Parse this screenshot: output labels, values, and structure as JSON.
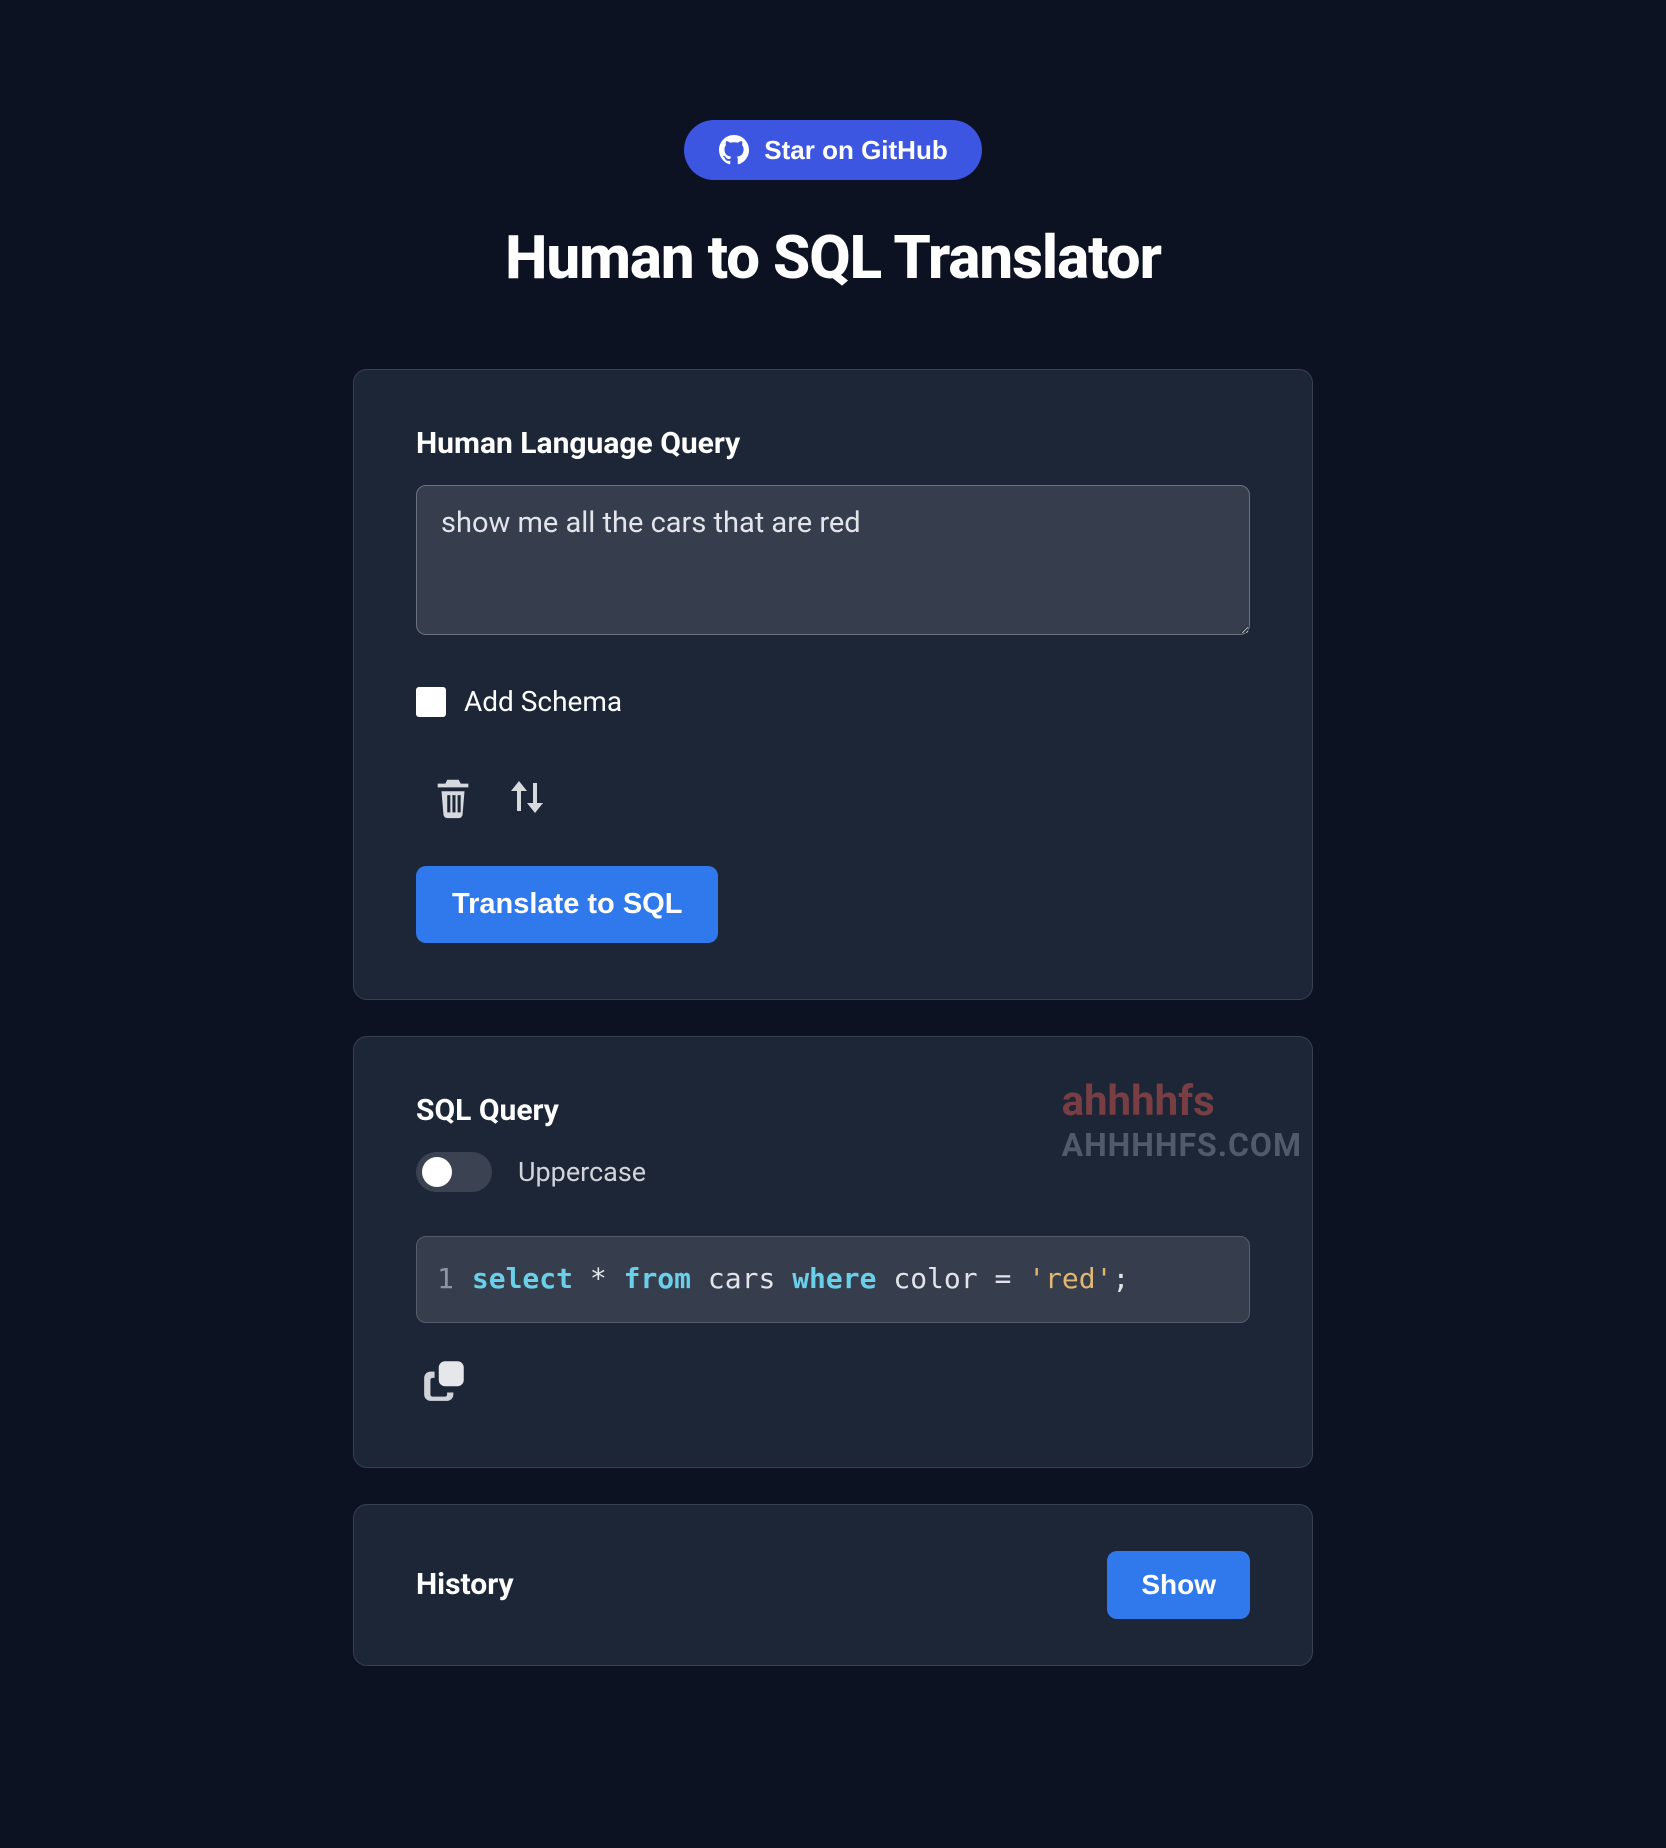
{
  "header": {
    "github_label": "Star on GitHub",
    "title": "Human to SQL Translator"
  },
  "input_card": {
    "label": "Human Language Query",
    "query_value": "show me all the cars that are red",
    "schema_checkbox_label": "Add Schema",
    "schema_checked": false,
    "translate_button": "Translate to SQL",
    "icons": {
      "trash": "trash-icon",
      "sort": "sort-icon"
    }
  },
  "output_card": {
    "label": "SQL Query",
    "toggle_label": "Uppercase",
    "toggle_on": false,
    "sql": {
      "line_number": "1",
      "tokens": [
        {
          "t": "select",
          "c": "kw"
        },
        {
          "t": " * ",
          "c": "op"
        },
        {
          "t": "from",
          "c": "kw"
        },
        {
          "t": " cars ",
          "c": "id"
        },
        {
          "t": "where",
          "c": "kw"
        },
        {
          "t": " color = ",
          "c": "id"
        },
        {
          "t": "'red'",
          "c": "str"
        },
        {
          "t": ";",
          "c": "op"
        }
      ],
      "raw": "select * from cars where color = 'red';"
    }
  },
  "history_card": {
    "label": "History",
    "show_button": "Show"
  },
  "watermark": {
    "line1": "ahhhhfs",
    "line2": "AHHHHFS.COM"
  }
}
